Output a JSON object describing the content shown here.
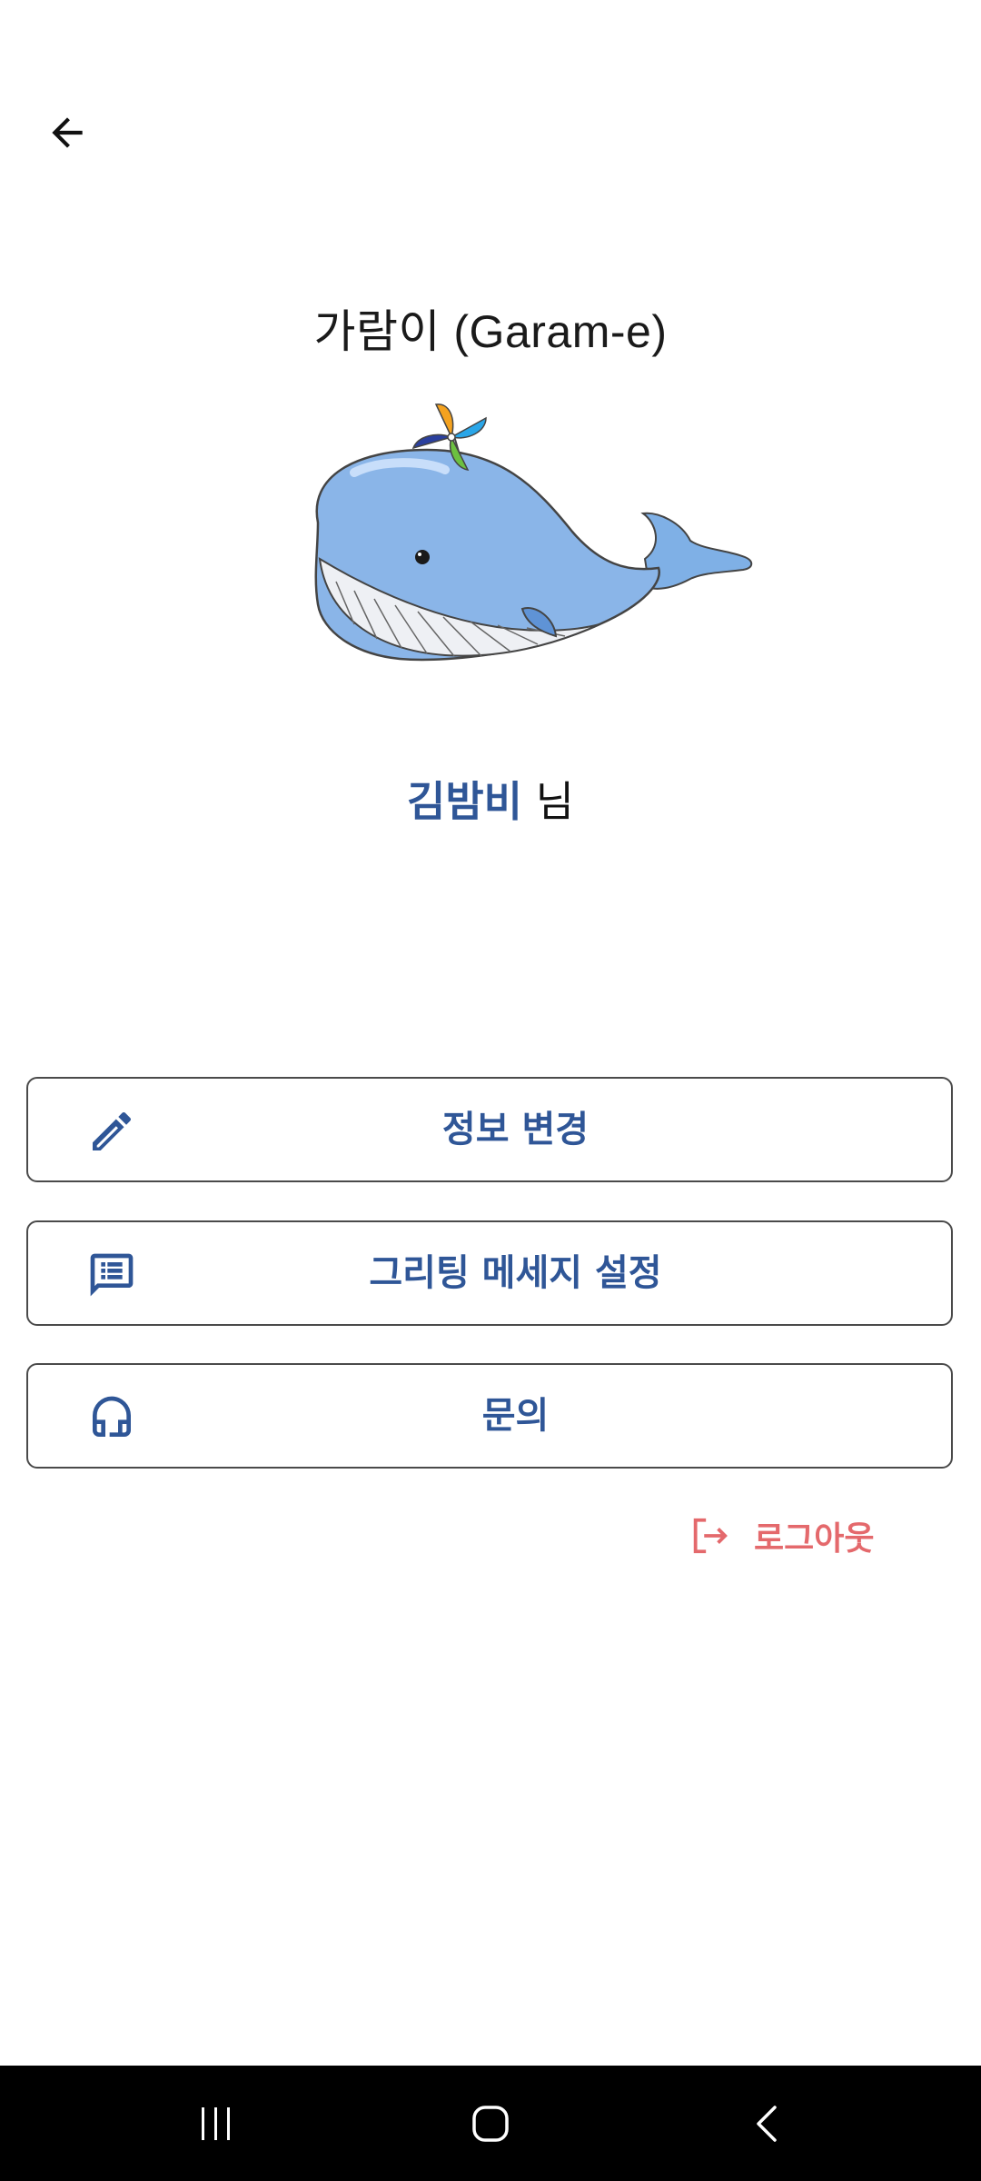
{
  "header": {
    "back_icon": "arrow-left-icon"
  },
  "app": {
    "title": "가람이 (Garam-e)",
    "mascot": "whale-with-pinwheel"
  },
  "user": {
    "name": "김밤비",
    "suffix": " 님",
    "name_color": "#2f5697"
  },
  "menu": {
    "items": [
      {
        "label": "정보 변경",
        "icon": "pencil-icon"
      },
      {
        "label": "그리팅 메세지 설정",
        "icon": "message-list-icon"
      },
      {
        "label": "문의",
        "icon": "headset-icon"
      }
    ],
    "label_color": "#2f5697"
  },
  "logout": {
    "label": "로그아웃",
    "icon": "logout-icon",
    "color": "#e4696c"
  },
  "system_nav": {
    "buttons": [
      "recent-apps-icon",
      "home-icon",
      "back-chevron-icon"
    ]
  }
}
